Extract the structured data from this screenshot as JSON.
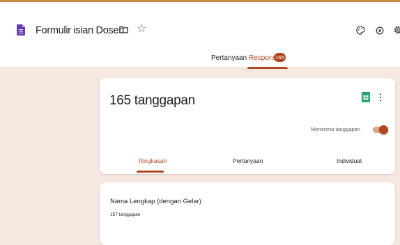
{
  "header": {
    "title": "Formulir isian Dosen"
  },
  "tabs": {
    "questions": "Pertanyaan",
    "responses": "Respons",
    "responses_badge": "165"
  },
  "summary": {
    "count_text": "165 tanggapan",
    "accepting_label": "Menerima tanggapan",
    "accepting": true,
    "subtabs": [
      "Ringkasan",
      "Pertanyaan",
      "Individual"
    ]
  },
  "question": {
    "title": "Nama Lengkap (dengan Gelar)",
    "response_count": "157 tanggapan"
  },
  "colors": {
    "accent": "#b04620",
    "page_background": "#f6e8e0",
    "sheets_green": "#23a566",
    "forms_purple": "#673ab7"
  }
}
